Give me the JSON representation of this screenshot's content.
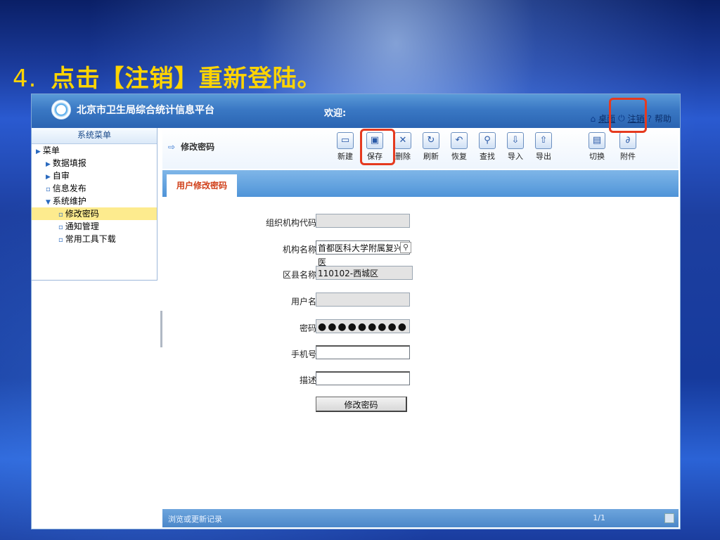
{
  "slide": {
    "number": "4.",
    "title": "点击【注销】重新登陆。"
  },
  "app": {
    "title": "北京市卫生局综合统计信息平台",
    "welcome": "欢迎:",
    "top_links": {
      "desktop": "桌面",
      "logout": "注销",
      "help": "帮助"
    }
  },
  "sidebar": {
    "header": "系统菜单",
    "items": [
      {
        "label": "菜单"
      },
      {
        "label": "数据填报"
      },
      {
        "label": "自审"
      },
      {
        "label": "信息发布"
      },
      {
        "label": "系统维护"
      },
      {
        "label": "修改密码"
      },
      {
        "label": "通知管理"
      },
      {
        "label": "常用工具下载"
      }
    ]
  },
  "toolbar": {
    "page_name": "修改密码",
    "buttons": {
      "new": "新建",
      "save": "保存",
      "delete": "删除",
      "refresh": "刷新",
      "restore": "恢复",
      "search": "查找",
      "import": "导入",
      "export": "导出",
      "switch": "切换",
      "attach": "附件"
    }
  },
  "tab": {
    "label": "用户修改密码"
  },
  "form": {
    "org_code_label": "组织机构代码:",
    "org_code_value": "",
    "org_name_label": "机构名称:",
    "org_name_value": "首都医科大学附属复兴医",
    "district_label": "区县名称:",
    "district_value": "110102-西城区",
    "username_label": "用户名:",
    "username_value": "",
    "password_label": "密码:",
    "password_value": "●●●●●●●●●",
    "mobile_label": "手机号:",
    "mobile_value": "",
    "desc_label": "描述:",
    "desc_value": "",
    "submit_label": "修改密码"
  },
  "footer": {
    "record_label": "浏览或更新记录",
    "page": "1/1"
  },
  "colors": {
    "highlight": "#e53a1f",
    "title": "#ffd400",
    "selected_row": "#fdeb8e"
  }
}
